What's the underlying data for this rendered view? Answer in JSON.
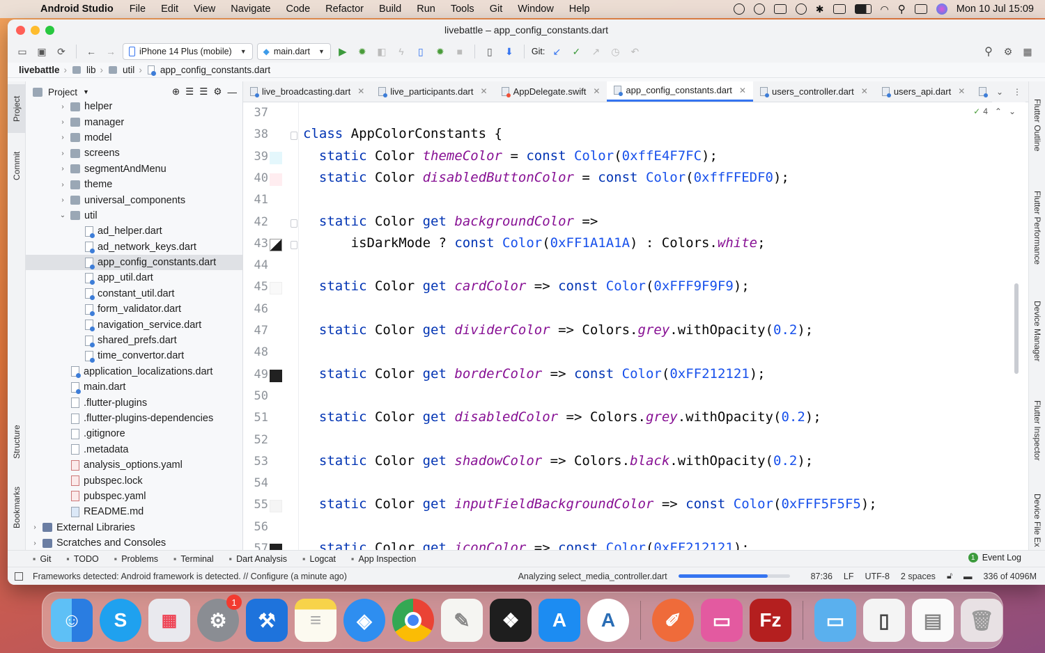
{
  "menubar": {
    "app": "Android Studio",
    "items": [
      "File",
      "Edit",
      "View",
      "Navigate",
      "Code",
      "Refactor",
      "Build",
      "Run",
      "Tools",
      "Git",
      "Window",
      "Help"
    ],
    "clock": "Mon 10 Jul  15:09"
  },
  "window": {
    "title": "livebattle – app_config_constants.dart"
  },
  "toolbar": {
    "device": "iPhone 14 Plus (mobile)",
    "run_config": "main.dart",
    "git_label": "Git:"
  },
  "breadcrumb": [
    "livebattle",
    "lib",
    "util",
    "app_config_constants.dart"
  ],
  "project": {
    "header": "Project",
    "rows": [
      {
        "label": "helper",
        "kind": "folder",
        "depth": 1,
        "arrow": "›"
      },
      {
        "label": "manager",
        "kind": "folder",
        "depth": 1,
        "arrow": "›"
      },
      {
        "label": "model",
        "kind": "folder",
        "depth": 1,
        "arrow": "›"
      },
      {
        "label": "screens",
        "kind": "folder",
        "depth": 1,
        "arrow": "›"
      },
      {
        "label": "segmentAndMenu",
        "kind": "folder",
        "depth": 1,
        "arrow": "›"
      },
      {
        "label": "theme",
        "kind": "folder",
        "depth": 1,
        "arrow": "›"
      },
      {
        "label": "universal_components",
        "kind": "folder",
        "depth": 1,
        "arrow": "›"
      },
      {
        "label": "util",
        "kind": "folder",
        "depth": 1,
        "arrow": "⌄"
      },
      {
        "label": "ad_helper.dart",
        "kind": "dart",
        "depth": 2
      },
      {
        "label": "ad_network_keys.dart",
        "kind": "dart",
        "depth": 2
      },
      {
        "label": "app_config_constants.dart",
        "kind": "dart",
        "depth": 2,
        "selected": true
      },
      {
        "label": "app_util.dart",
        "kind": "dart",
        "depth": 2
      },
      {
        "label": "constant_util.dart",
        "kind": "dart",
        "depth": 2
      },
      {
        "label": "form_validator.dart",
        "kind": "dart",
        "depth": 2
      },
      {
        "label": "navigation_service.dart",
        "kind": "dart",
        "depth": 2
      },
      {
        "label": "shared_prefs.dart",
        "kind": "dart",
        "depth": 2
      },
      {
        "label": "time_convertor.dart",
        "kind": "dart",
        "depth": 2
      },
      {
        "label": "application_localizations.dart",
        "kind": "dart",
        "depth": 1
      },
      {
        "label": "main.dart",
        "kind": "dart",
        "depth": 1
      },
      {
        "label": ".flutter-plugins",
        "kind": "file",
        "depth": 0
      },
      {
        "label": ".flutter-plugins-dependencies",
        "kind": "file",
        "depth": 0
      },
      {
        "label": ".gitignore",
        "kind": "file",
        "depth": 0
      },
      {
        "label": ".metadata",
        "kind": "file",
        "depth": 0
      },
      {
        "label": "analysis_options.yaml",
        "kind": "yml",
        "depth": 0
      },
      {
        "label": "pubspec.lock",
        "kind": "yml",
        "depth": 0
      },
      {
        "label": "pubspec.yaml",
        "kind": "yml",
        "depth": 0
      },
      {
        "label": "README.md",
        "kind": "md",
        "depth": 0
      },
      {
        "label": "External Libraries",
        "kind": "lib",
        "depth": -1,
        "arrow": "›"
      },
      {
        "label": "Scratches and Consoles",
        "kind": "lib",
        "depth": -1,
        "arrow": "›"
      }
    ]
  },
  "left_strip": [
    "Project",
    "Commit",
    "Structure",
    "Bookmarks"
  ],
  "right_strip": [
    "Flutter Outline",
    "Flutter Performance",
    "Device Manager",
    "Flutter Inspector",
    "Device File Ex"
  ],
  "tabs": [
    {
      "label": "live_broadcasting.dart",
      "kind": "dart"
    },
    {
      "label": "live_participants.dart",
      "kind": "dart"
    },
    {
      "label": "AppDelegate.swift",
      "kind": "swift"
    },
    {
      "label": "app_config_constants.dart",
      "kind": "dart",
      "active": true
    },
    {
      "label": "users_controller.dart",
      "kind": "dart"
    },
    {
      "label": "users_api.dart",
      "kind": "dart"
    }
  ],
  "inspection_count": "4",
  "code": [
    {
      "n": "37",
      "html": ""
    },
    {
      "n": "38",
      "html": "<span class=\"kw\">class</span> AppColorConstants {"
    },
    {
      "n": "39",
      "html": "  <span class=\"kw\">static</span> Color <span class=\"fn\">themeColor</span> = <span class=\"kw\">const</span> <span class=\"ty\">Color</span>(<span class=\"num\">0xffE4F7FC</span>);",
      "swatch": "#E4F7FC"
    },
    {
      "n": "40",
      "html": "  <span class=\"kw\">static</span> Color <span class=\"fn\">disabledButtonColor</span> = <span class=\"kw\">const</span> <span class=\"ty\">Color</span>(<span class=\"num\">0xffFFEDF0</span>);",
      "swatch": "#FFEDF0"
    },
    {
      "n": "41",
      "html": ""
    },
    {
      "n": "42",
      "html": "  <span class=\"kw\">static</span> Color <span class=\"kw\">get</span> <span class=\"fn\">backgroundColor</span> =>"
    },
    {
      "n": "43",
      "html": "      isDarkMode ? <span class=\"kw\">const</span> <span class=\"ty\">Color</span>(<span class=\"num\">0xFF1A1A1A</span>) : Colors.<span class=\"fn\">white</span>;",
      "swatch": "split"
    },
    {
      "n": "44",
      "html": ""
    },
    {
      "n": "45",
      "html": "  <span class=\"kw\">static</span> Color <span class=\"kw\">get</span> <span class=\"fn\">cardColor</span> => <span class=\"kw\">const</span> <span class=\"ty\">Color</span>(<span class=\"num\">0xFFF9F9F9</span>);",
      "swatch": "#F9F9F9"
    },
    {
      "n": "46",
      "html": ""
    },
    {
      "n": "47",
      "html": "  <span class=\"kw\">static</span> Color <span class=\"kw\">get</span> <span class=\"fn\">dividerColor</span> => Colors.<span class=\"fn\">grey</span>.withOpacity(<span class=\"num\">0.2</span>);"
    },
    {
      "n": "48",
      "html": ""
    },
    {
      "n": "49",
      "html": "  <span class=\"kw\">static</span> Color <span class=\"kw\">get</span> <span class=\"fn\">borderColor</span> => <span class=\"kw\">const</span> <span class=\"ty\">Color</span>(<span class=\"num\">0xFF212121</span>);",
      "swatch": "#212121"
    },
    {
      "n": "50",
      "html": ""
    },
    {
      "n": "51",
      "html": "  <span class=\"kw\">static</span> Color <span class=\"kw\">get</span> <span class=\"fn\">disabledColor</span> => Colors.<span class=\"fn\">grey</span>.withOpacity(<span class=\"num\">0.2</span>);"
    },
    {
      "n": "52",
      "html": ""
    },
    {
      "n": "53",
      "html": "  <span class=\"kw\">static</span> Color <span class=\"kw\">get</span> <span class=\"fn\">shadowColor</span> => Colors.<span class=\"fn\">black</span>.withOpacity(<span class=\"num\">0.2</span>);"
    },
    {
      "n": "54",
      "html": ""
    },
    {
      "n": "55",
      "html": "  <span class=\"kw\">static</span> Color <span class=\"kw\">get</span> <span class=\"fn\">inputFieldBackgroundColor</span> => <span class=\"kw\">const</span> <span class=\"ty\">Color</span>(<span class=\"num\">0xFFF5F5F5</span>);",
      "swatch": "#F5F5F5"
    },
    {
      "n": "56",
      "html": ""
    },
    {
      "n": "57",
      "html": "  <span class=\"kw\">static</span> Color <span class=\"kw\">get</span> <span class=\"fn\">iconColor</span> => <span class=\"kw\">const</span> <span class=\"ty\">Color</span>(<span class=\"num\">0xFF212121</span>);",
      "swatch": "#212121"
    }
  ],
  "bottom_tools": [
    {
      "icon": "git-icon",
      "label": "Git"
    },
    {
      "icon": "todo-icon",
      "label": "TODO"
    },
    {
      "icon": "problems-icon",
      "label": "Problems"
    },
    {
      "icon": "terminal-icon",
      "label": "Terminal"
    },
    {
      "icon": "dart-analysis-icon",
      "label": "Dart Analysis"
    },
    {
      "icon": "logcat-icon",
      "label": "Logcat"
    },
    {
      "icon": "app-inspection-icon",
      "label": "App Inspection"
    }
  ],
  "event_log": {
    "label": "Event Log",
    "count": "1"
  },
  "status": {
    "message": "Frameworks detected: Android framework is detected. // Configure (a minute ago)",
    "task": "Analyzing select_media_controller.dart",
    "task_progress": 0.8,
    "position": "87:36",
    "line_sep": "LF",
    "encoding": "UTF-8",
    "indent": "2 spaces",
    "memory": "336 of 4096M"
  },
  "dock": {
    "settings_badge": "1"
  },
  "colors": {
    "accent": "#3574f0",
    "keyword": "#0033b3",
    "field": "#871094",
    "number": "#1750eb"
  }
}
